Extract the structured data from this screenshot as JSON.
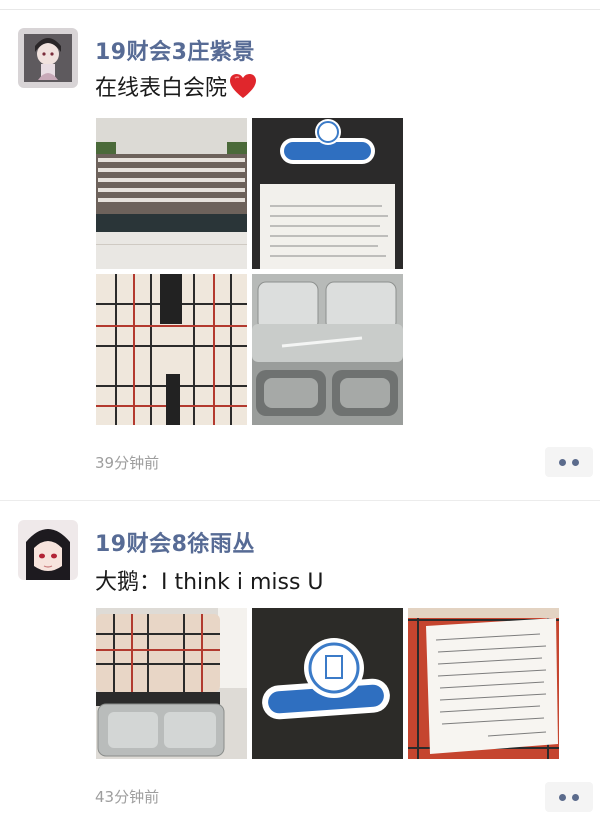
{
  "posts": [
    {
      "author": "19财会3庄紫景",
      "text": "在线表白会院",
      "time": "39分钟前",
      "photo_subjects": [
        "lunch-boxes-rows-photo",
        "handwritten-card-photo",
        "plaid-bag-photo",
        "steel-lunch-box-photo"
      ]
    },
    {
      "author": "19财会8徐雨丛",
      "text": "大鹅：I think i miss U",
      "time": "43分钟前",
      "photo_subjects": [
        "plaid-lunch-bag-photo",
        "badge-sticker-photo",
        "handwritten-note-photo"
      ]
    }
  ],
  "colors": {
    "author_name": "#576b95",
    "time_text": "#9e9e9e",
    "more_dots": "#5b6b8c"
  }
}
